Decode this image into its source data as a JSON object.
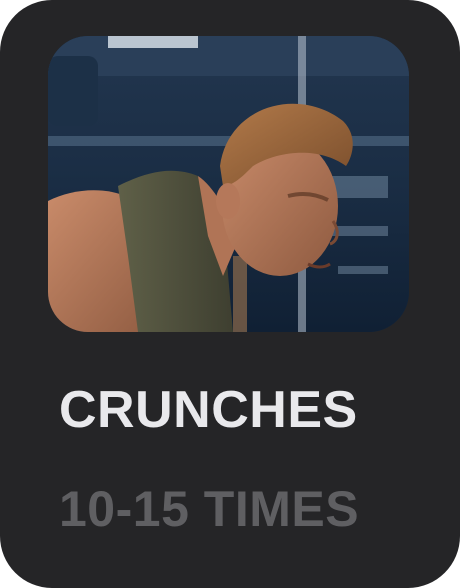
{
  "exercise_card": {
    "title": "CRUNCHES",
    "reps": "10-15 TIMES",
    "image_icon": "exercise-photo-icon"
  },
  "colors": {
    "card_background": "#252527",
    "title_text": "#e9e9ec",
    "reps_text": "#5f5f62"
  }
}
